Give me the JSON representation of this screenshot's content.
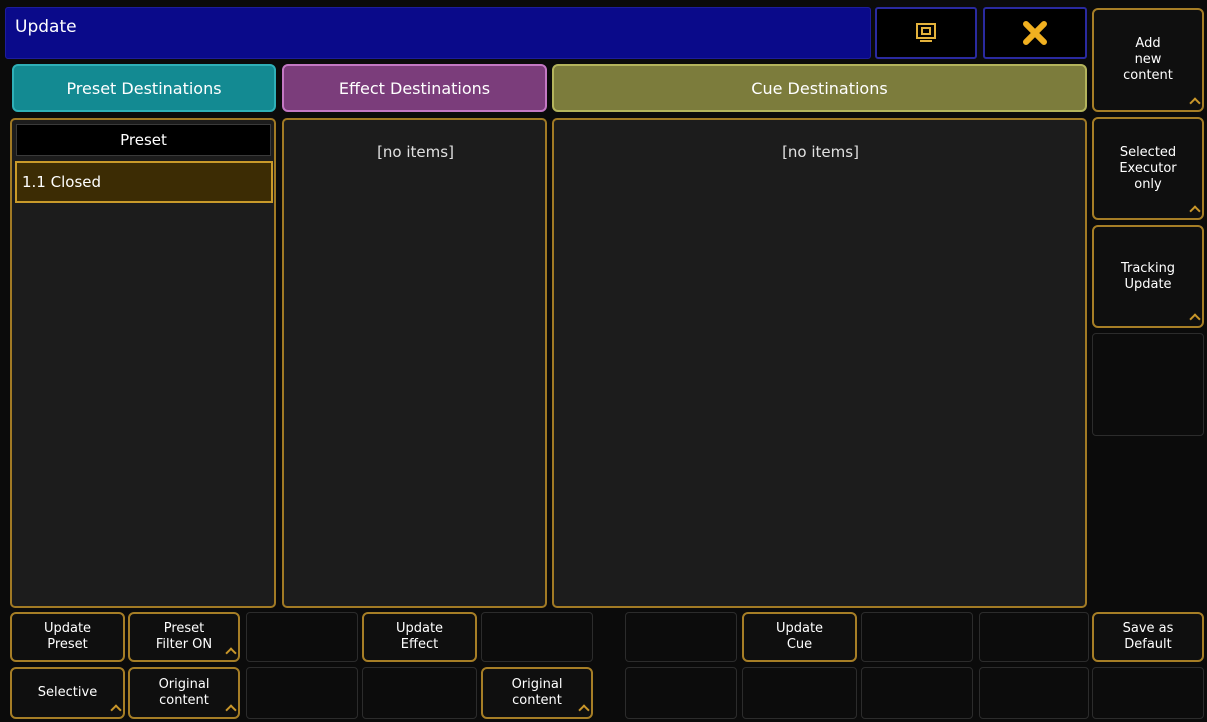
{
  "window": {
    "title": "Update"
  },
  "tabs": {
    "preset": "Preset Destinations",
    "effect": "Effect Destinations",
    "cue": "Cue Destinations"
  },
  "preset_list": {
    "header": "Preset",
    "items": [
      "1.1 Closed"
    ]
  },
  "effect_list": {
    "empty_text": "[no items]"
  },
  "cue_list": {
    "empty_text": "[no items]"
  },
  "side_buttons": {
    "add_new_content": "Add\nnew\ncontent",
    "selected_executor_only": "Selected\nExecutor\nonly",
    "tracking_update": "Tracking\nUpdate",
    "save_as_default": "Save as\nDefault"
  },
  "bottom_row1": {
    "update_preset": "Update\nPreset",
    "preset_filter": "Preset\nFilter ON",
    "update_effect": "Update\nEffect",
    "update_cue": "Update\nCue"
  },
  "bottom_row2": {
    "selective": "Selective",
    "original_content_preset": "Original\ncontent",
    "original_content_effect": "Original\ncontent"
  },
  "colors": {
    "title_bar": "#0a0a8a",
    "preset_tab": "#138a92",
    "effect_tab": "#7b3d7b",
    "cue_tab": "#7c7c3c",
    "accent_border": "#a67e26"
  },
  "icons": {
    "screen": "screen-select-icon",
    "close": "close-icon"
  }
}
